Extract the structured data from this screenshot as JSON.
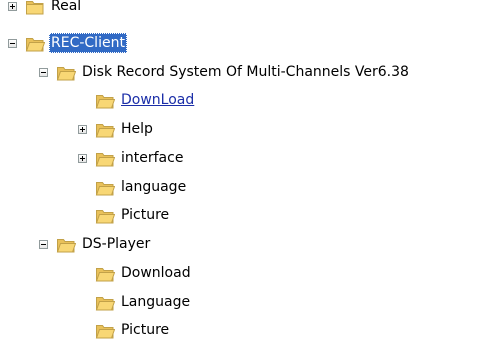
{
  "colors": {
    "selection_background": "#316ac5",
    "selection_text": "#ffffff",
    "link_text": "#1b2ea8",
    "folder_fill": "#f8d775",
    "folder_border": "#c2a148"
  },
  "tree": {
    "nodes": [
      {
        "id": "real",
        "label": "Real",
        "depth": 0,
        "expander": "plus",
        "folder": "closed-folder-icon"
      },
      {
        "id": "rec-client",
        "label": "REC-Client",
        "depth": 0,
        "expander": "minus",
        "folder": "open-folder-icon",
        "state": "selected"
      },
      {
        "id": "disk-record",
        "label": "Disk Record System Of Multi-Channels Ver6.38",
        "depth": 1,
        "expander": "minus",
        "folder": "open-folder-icon"
      },
      {
        "id": "download-1",
        "label": "DownLoad",
        "depth": 2,
        "expander": "none",
        "folder": "open-folder-icon",
        "state": "hover-link"
      },
      {
        "id": "help",
        "label": "Help",
        "depth": 2,
        "expander": "plus",
        "folder": "open-folder-icon"
      },
      {
        "id": "interface",
        "label": "interface",
        "depth": 2,
        "expander": "plus",
        "folder": "open-folder-icon"
      },
      {
        "id": "language-1",
        "label": "language",
        "depth": 2,
        "expander": "none",
        "folder": "open-folder-icon"
      },
      {
        "id": "picture-1",
        "label": "Picture",
        "depth": 2,
        "expander": "none",
        "folder": "open-folder-icon"
      },
      {
        "id": "ds-player",
        "label": "DS-Player",
        "depth": 1,
        "expander": "minus",
        "folder": "open-folder-icon"
      },
      {
        "id": "download-2",
        "label": "Download",
        "depth": 2,
        "expander": "none",
        "folder": "open-folder-icon"
      },
      {
        "id": "language-2",
        "label": "Language",
        "depth": 2,
        "expander": "none",
        "folder": "open-folder-icon"
      },
      {
        "id": "picture-2",
        "label": "Picture",
        "depth": 2,
        "expander": "none",
        "folder": "open-folder-icon"
      }
    ]
  }
}
